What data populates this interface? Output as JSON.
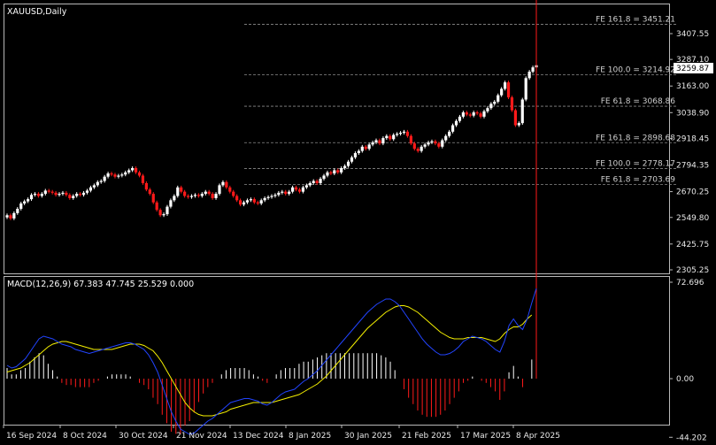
{
  "window": {
    "title": "XAUUSD,Daily"
  },
  "macd_label": "MACD(12,26,9) 67.383 47.745 25.529 0.000",
  "current_price": "3259.87",
  "colors": {
    "up": "#ffffff",
    "down": "#ff1a1a",
    "macd_line": "#2244ff",
    "signal_line": "#f5f000",
    "fib_line": "#8a8a8a",
    "background": "#000000"
  },
  "chart_data": [
    {
      "type": "candlestick",
      "title": "XAUUSD,Daily",
      "y_ticks": [
        "3407.55",
        "3287.10",
        "3163.00",
        "3038.90",
        "2918.45",
        "2794.35",
        "2670.25",
        "2549.80",
        "2425.75",
        "2305.25"
      ],
      "ylim": [
        2305.25,
        3451.21
      ],
      "x_ticks": [
        "16 Sep 2024",
        "8 Oct 2024",
        "30 Oct 2024",
        "21 Nov 2024",
        "13 Dec 2024",
        "8 Jan 2025",
        "30 Jan 2025",
        "21 Feb 2025",
        "17 Mar 2025",
        "8 Apr 2025"
      ],
      "fibonacci_levels": [
        {
          "label": "FE 161.8 = 3451.21",
          "value": 3451.21
        },
        {
          "label": "FE 100.0 = 3214.92",
          "value": 3214.92
        },
        {
          "label": "FE 61.8 = 3068.86",
          "value": 3068.86
        },
        {
          "label": "FE 161.8 = 2898.68",
          "value": 2898.68
        },
        {
          "label": "FE 100.0 = 2778.17",
          "value": 2778.17
        },
        {
          "label": "FE 61.8 = 2703.69",
          "value": 2703.69
        }
      ],
      "close": [
        2560,
        2545,
        2570,
        2590,
        2615,
        2625,
        2635,
        2655,
        2660,
        2650,
        2660,
        2675,
        2670,
        2665,
        2655,
        2660,
        2665,
        2655,
        2640,
        2650,
        2660,
        2655,
        2665,
        2675,
        2690,
        2700,
        2715,
        2720,
        2740,
        2755,
        2750,
        2740,
        2745,
        2750,
        2760,
        2770,
        2780,
        2760,
        2745,
        2710,
        2680,
        2660,
        2620,
        2585,
        2560,
        2565,
        2600,
        2630,
        2650,
        2690,
        2670,
        2650,
        2645,
        2650,
        2655,
        2650,
        2660,
        2670,
        2660,
        2640,
        2660,
        2700,
        2715,
        2690,
        2670,
        2650,
        2630,
        2610,
        2620,
        2630,
        2635,
        2620,
        2615,
        2630,
        2640,
        2645,
        2650,
        2655,
        2665,
        2670,
        2660,
        2670,
        2690,
        2680,
        2670,
        2690,
        2700,
        2710,
        2720,
        2710,
        2730,
        2745,
        2760,
        2755,
        2770,
        2760,
        2780,
        2790,
        2810,
        2830,
        2850,
        2860,
        2880,
        2870,
        2890,
        2900,
        2910,
        2895,
        2920,
        2930,
        2915,
        2935,
        2940,
        2945,
        2950,
        2930,
        2895,
        2870,
        2860,
        2880,
        2890,
        2900,
        2905,
        2895,
        2880,
        2910,
        2930,
        2950,
        2980,
        3000,
        3020,
        3040,
        3030,
        3025,
        3040,
        3035,
        3020,
        3045,
        3060,
        3080,
        3090,
        3120,
        3150,
        3180,
        3110,
        3050,
        2980,
        2990,
        3100,
        3200,
        3230,
        3250,
        3260
      ],
      "macd": [
        10,
        8,
        9,
        12,
        15,
        20,
        25,
        30,
        32,
        31,
        30,
        28,
        26,
        25,
        24,
        22,
        21,
        20,
        19,
        20,
        21,
        22,
        23,
        24,
        25,
        26,
        27,
        27,
        26,
        24,
        22,
        18,
        12,
        5,
        -5,
        -15,
        -25,
        -32,
        -38,
        -40,
        -42,
        -41,
        -38,
        -35,
        -32,
        -30,
        -27,
        -24,
        -21,
        -18,
        -17,
        -16,
        -15,
        -15,
        -16,
        -17,
        -19,
        -20,
        -18,
        -15,
        -12,
        -10,
        -9,
        -8,
        -5,
        -2,
        0,
        3,
        6,
        10,
        14,
        18,
        22,
        26,
        30,
        34,
        38,
        42,
        46,
        50,
        53,
        56,
        58,
        60,
        60,
        58,
        55,
        50,
        45,
        40,
        35,
        30,
        26,
        23,
        20,
        18,
        18,
        19,
        21,
        24,
        28,
        30,
        32,
        31,
        30,
        28,
        25,
        22,
        20,
        28,
        40,
        45,
        40,
        37,
        45,
        57,
        68
      ],
      "signal": [
        5,
        6,
        7,
        8,
        10,
        12,
        15,
        18,
        21,
        24,
        26,
        27,
        28,
        28,
        27,
        26,
        25,
        24,
        23,
        22,
        22,
        22,
        22,
        22,
        23,
        24,
        25,
        26,
        26,
        26,
        25,
        23,
        21,
        17,
        12,
        6,
        0,
        -6,
        -12,
        -18,
        -22,
        -25,
        -27,
        -28,
        -28,
        -28,
        -27,
        -26,
        -25,
        -23,
        -22,
        -21,
        -20,
        -19,
        -18,
        -18,
        -18,
        -18,
        -18,
        -17,
        -16,
        -15,
        -14,
        -13,
        -12,
        -10,
        -8,
        -6,
        -4,
        -1,
        2,
        6,
        10,
        14,
        18,
        22,
        26,
        30,
        34,
        38,
        41,
        44,
        47,
        50,
        52,
        54,
        55,
        55,
        54,
        52,
        50,
        47,
        44,
        41,
        38,
        35,
        33,
        31,
        30,
        30,
        30,
        31,
        31,
        31,
        31,
        30,
        29,
        28,
        30,
        34,
        37,
        39,
        39,
        41,
        45,
        48
      ],
      "macd_y_ticks": [
        "72.696",
        "0.00",
        "-44.202"
      ],
      "macd_ylim": [
        -44.202,
        72.696
      ]
    }
  ]
}
